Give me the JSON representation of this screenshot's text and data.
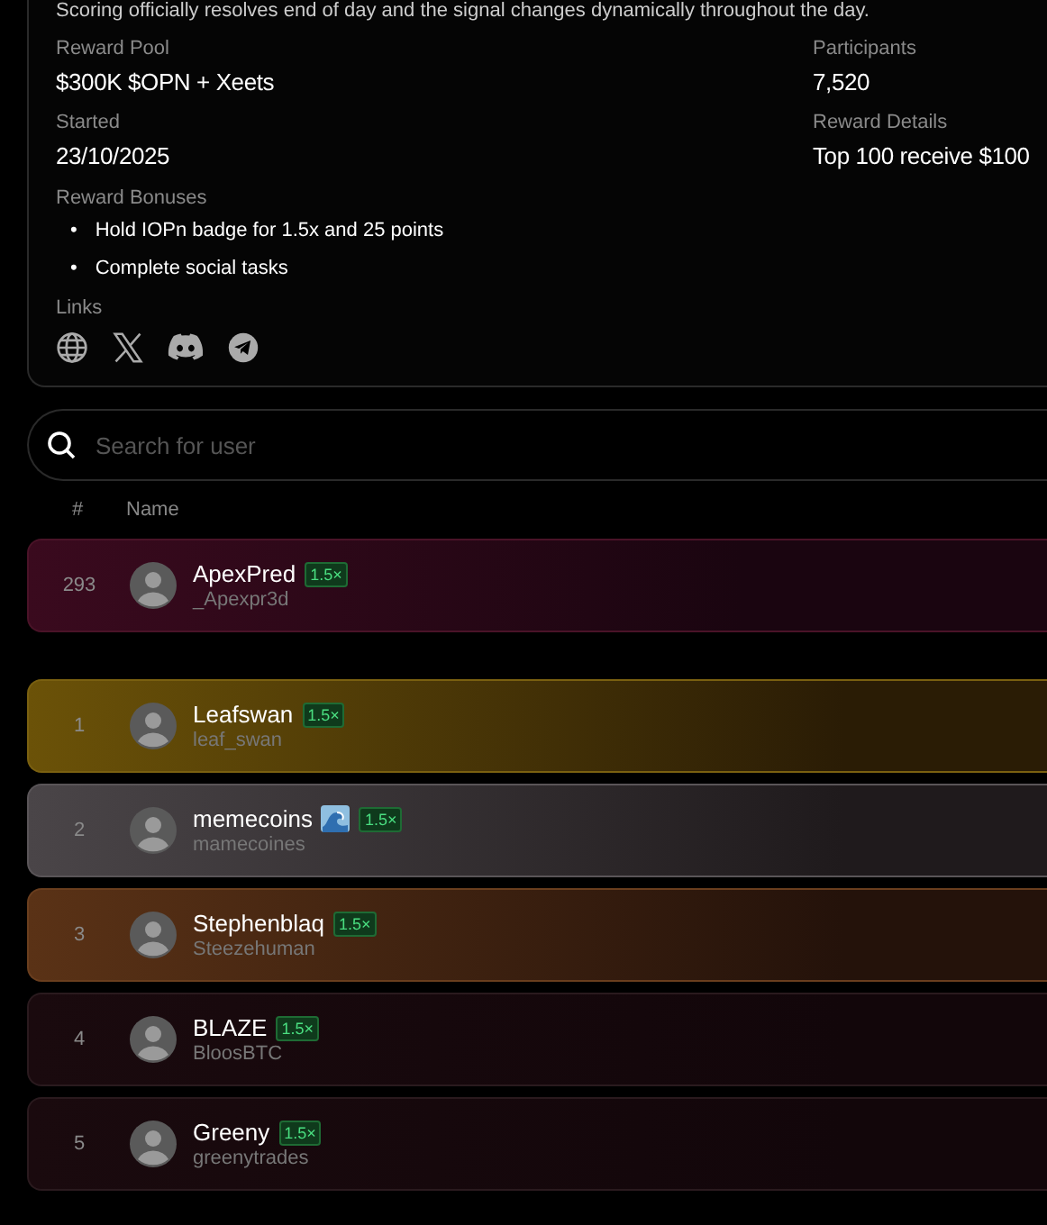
{
  "info": {
    "description": "Scoring officially resolves end of day and the signal changes dynamically throughout the day.",
    "fields": [
      {
        "label": "Reward Pool",
        "value": "$300K $OPN + Xeets"
      },
      {
        "label": "Participants",
        "value": "7,520"
      },
      {
        "label": "Started",
        "value": "23/10/2025"
      },
      {
        "label": "Reward Details",
        "value": "Top 100 receive $100"
      }
    ],
    "bonuses_label": "Reward Bonuses",
    "bonuses": [
      {
        "bullet": "•",
        "text": "Hold IOPn badge for 1.5x and 25 points"
      },
      {
        "bullet": "•",
        "text": "Complete social tasks"
      }
    ],
    "links_label": "Links"
  },
  "search": {
    "placeholder": "Search for user"
  },
  "table": {
    "columns": [
      "#",
      "Name"
    ],
    "rows": [
      {
        "kind": "you",
        "rank": "293",
        "name": "ApexPred",
        "handle": "_Apexpr3d",
        "multiplier": "1.5×",
        "wave_icon": false
      },
      {
        "kind": "gold",
        "rank": "1",
        "name": "Leafswan",
        "handle": "leaf_swan",
        "multiplier": "1.5×",
        "wave_icon": false
      },
      {
        "kind": "silver",
        "rank": "2",
        "name": "memecoins",
        "handle": "mamecoines",
        "multiplier": "1.5×",
        "wave_icon": true
      },
      {
        "kind": "bronze",
        "rank": "3",
        "name": "Stephenblaq",
        "handle": "Steezehuman",
        "multiplier": "1.5×",
        "wave_icon": false
      },
      {
        "kind": "plain",
        "rank": "4",
        "name": "BLAZE",
        "handle": "BloosBTC",
        "multiplier": "1.5×",
        "wave_icon": false
      },
      {
        "kind": "plain",
        "rank": "5",
        "name": "Greeny",
        "handle": "greenytrades",
        "multiplier": "1.5×",
        "wave_icon": false
      }
    ]
  }
}
